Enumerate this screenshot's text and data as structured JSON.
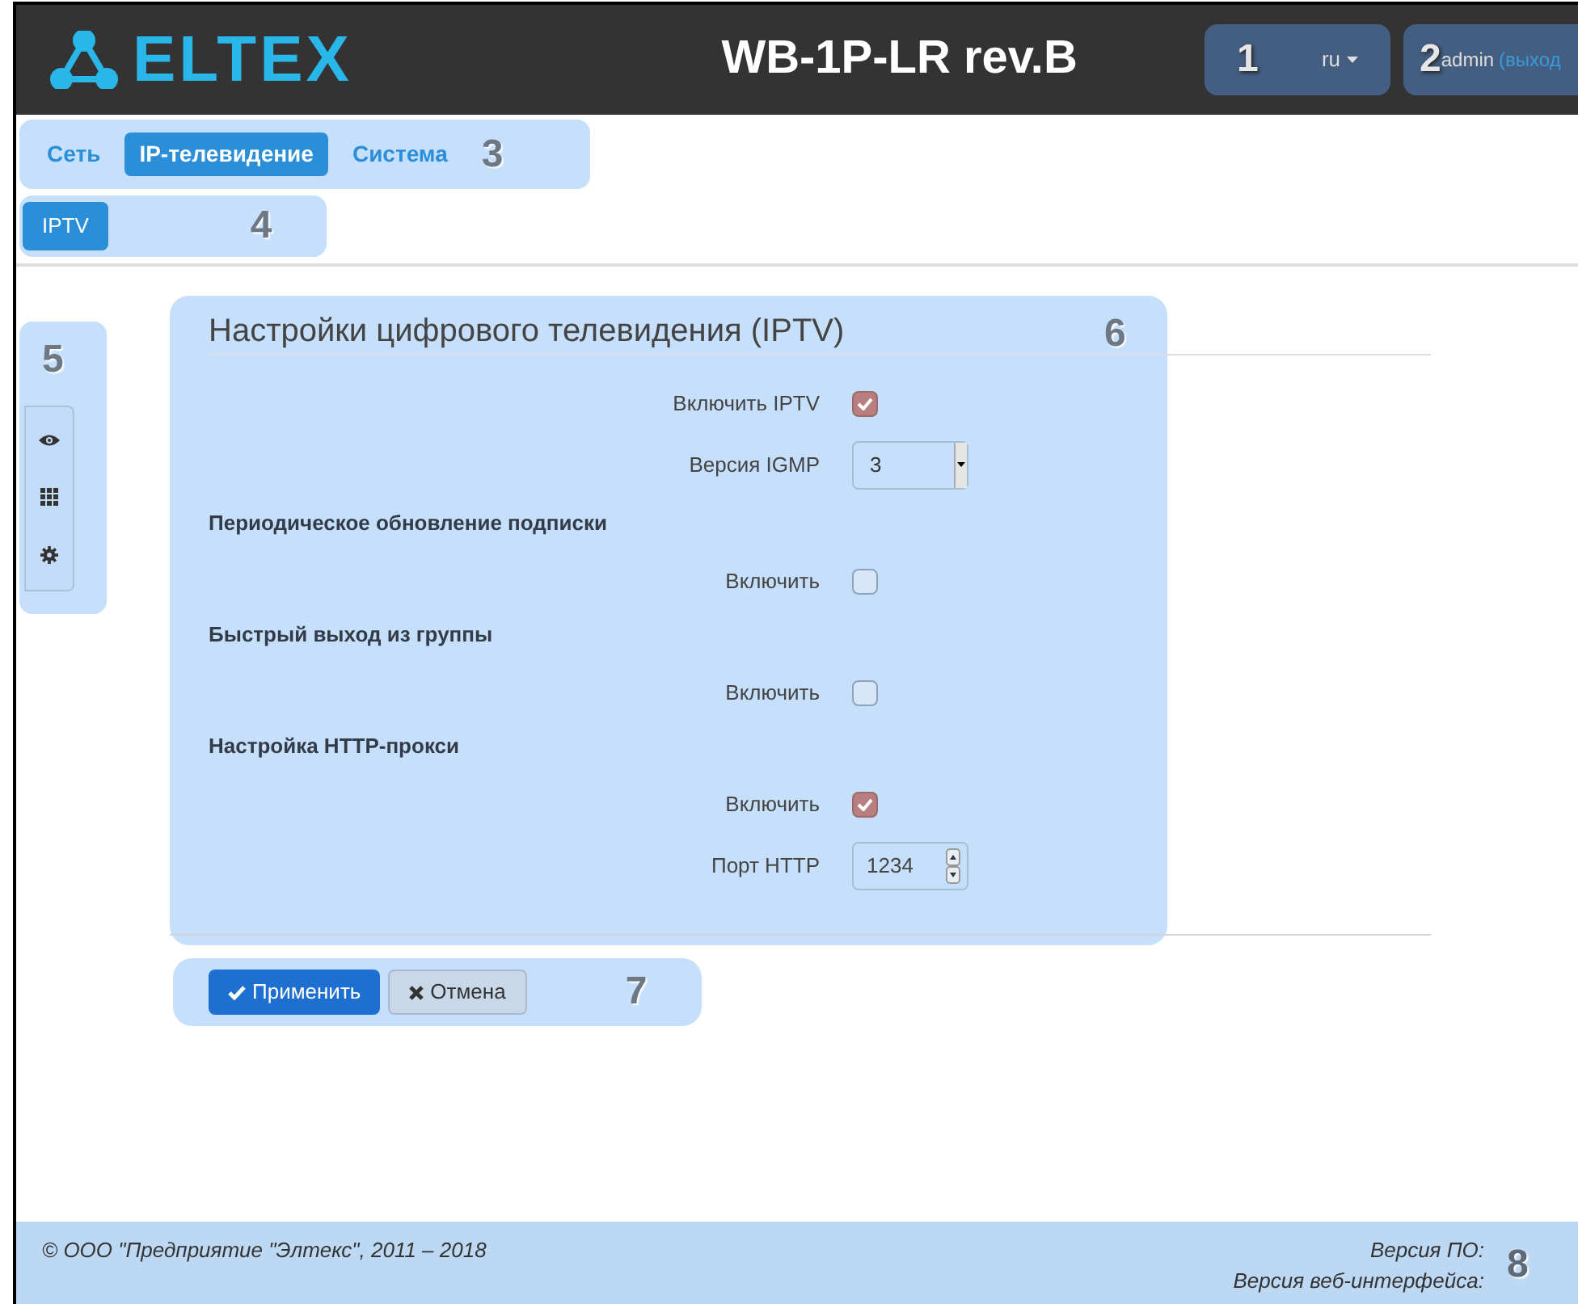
{
  "header": {
    "logo": "ELTEX",
    "title": "WB-1P-LR rev.B",
    "lang_callout": "1",
    "language": "ru",
    "user_callout": "2",
    "user": "admin",
    "logout": "(выход"
  },
  "nav": {
    "callout": "3",
    "tabs": [
      {
        "label": "Сеть",
        "selected": false
      },
      {
        "label": "IP-телевидение",
        "selected": true
      },
      {
        "label": "Система",
        "selected": false
      }
    ]
  },
  "subnav": {
    "callout": "4",
    "tabs": [
      {
        "label": "IPTV",
        "selected": true
      }
    ]
  },
  "sidebar": {
    "callout": "5"
  },
  "panel": {
    "title": "Настройки цифрового телевидения (IPTV)",
    "callout": "6",
    "rows": [
      {
        "kind": "checkbox",
        "label": "Включить IPTV",
        "checked": true
      },
      {
        "kind": "select",
        "label": "Версия IGMP",
        "value": "3"
      },
      {
        "kind": "heading",
        "label": "Периодическое обновление подписки"
      },
      {
        "kind": "checkbox",
        "label": "Включить",
        "checked": false
      },
      {
        "kind": "heading",
        "label": "Быстрый выход из группы"
      },
      {
        "kind": "checkbox",
        "label": "Включить",
        "checked": false
      },
      {
        "kind": "heading",
        "label": "Настройка HTTP-прокси"
      },
      {
        "kind": "checkbox",
        "label": "Включить",
        "checked": true
      },
      {
        "kind": "number",
        "label": "Порт HTTP",
        "value": "1234"
      }
    ]
  },
  "actions": {
    "callout": "7",
    "buttons": [
      {
        "kind": "primary",
        "label": "Применить"
      },
      {
        "kind": "default",
        "label": "Отмена"
      }
    ]
  },
  "footer": {
    "copyright": "© ООО \"Предприятие \"Элтекс\", 2011 – 2018",
    "version_labels": [
      "Версия ПО:",
      "Версия веб-интерфейса:"
    ],
    "callout": "8"
  }
}
